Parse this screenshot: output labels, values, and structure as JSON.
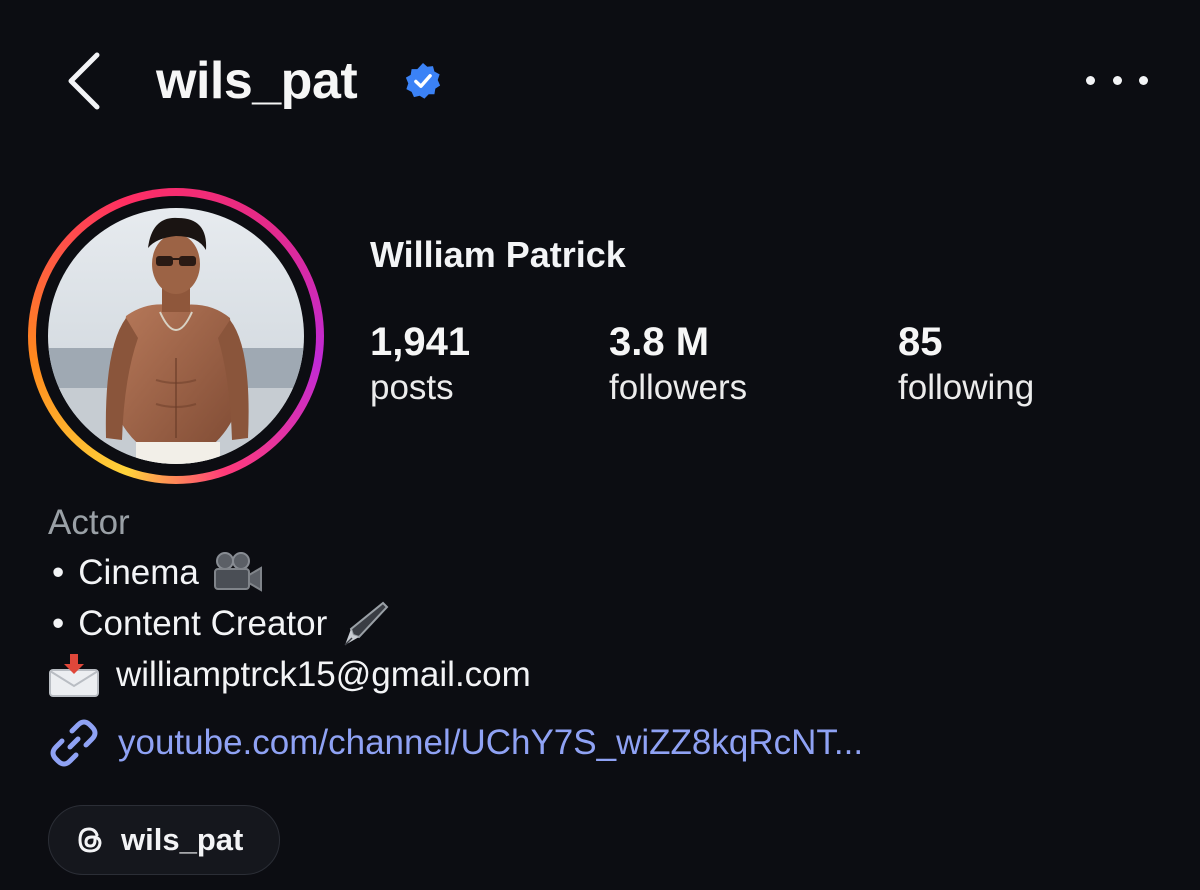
{
  "header": {
    "username": "wils_pat",
    "verified": true,
    "back_icon": "chevron-left-icon",
    "more_icon": "more-horizontal-icon",
    "verified_color": "#3b82f6"
  },
  "profile": {
    "display_name": "William Patrick",
    "avatar_ring_colors": [
      "#ffd33a",
      "#ff2e63",
      "#c02ad6"
    ],
    "stats": [
      {
        "value": "1,941",
        "label": "posts"
      },
      {
        "value": "3.8 M",
        "label": "followers"
      },
      {
        "value": "85",
        "label": "following"
      }
    ]
  },
  "bio": {
    "category": "Actor",
    "lines": [
      {
        "bullet": "•",
        "text": "Cinema",
        "emoji": "movie-camera-icon"
      },
      {
        "bullet": "•",
        "text": "Content Creator",
        "emoji": "fountain-pen-icon"
      }
    ],
    "email": "williamptrck15@gmail.com",
    "email_icon": "envelope-with-arrow-icon",
    "link": "youtube.com/channel/UChY7S_wiZZ8kqRcNT...",
    "link_icon": "link-icon",
    "link_color": "#8fa2f4"
  },
  "threads": {
    "label": "wils_pat",
    "icon": "threads-icon"
  }
}
